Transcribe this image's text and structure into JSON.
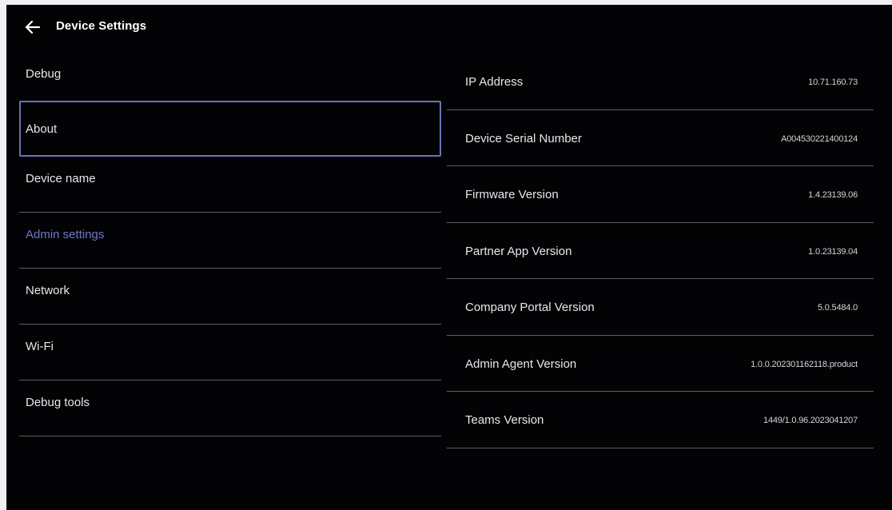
{
  "header": {
    "title": "Device Settings",
    "back_icon": "arrow-left-icon"
  },
  "sidebar": {
    "items": [
      {
        "label": "Debug"
      },
      {
        "label": "About",
        "state": "focused"
      },
      {
        "label": "Device name"
      },
      {
        "label": "Admin settings",
        "state": "highlighted"
      },
      {
        "label": "Network"
      },
      {
        "label": "Wi-Fi"
      },
      {
        "label": "Debug tools"
      }
    ]
  },
  "details": {
    "rows": [
      {
        "label": "IP Address",
        "value": "10.71.160.73"
      },
      {
        "label": "Device Serial Number",
        "value": "A004530221400124"
      },
      {
        "label": "Firmware Version",
        "value": "1.4.23139.06"
      },
      {
        "label": "Partner App Version",
        "value": "1.0.23139.04"
      },
      {
        "label": "Company Portal Version",
        "value": "5.0.5484.0"
      },
      {
        "label": "Admin Agent Version",
        "value": "1.0.0.202301162118.product"
      },
      {
        "label": "Teams Version",
        "value": "1449/1.0.96.2023041207"
      }
    ]
  },
  "colors": {
    "background": "#030305",
    "accent": "#6e76c9",
    "focus_border": "#6b73b5",
    "divider": "#5e5e66",
    "text": "#e8e8ec"
  }
}
